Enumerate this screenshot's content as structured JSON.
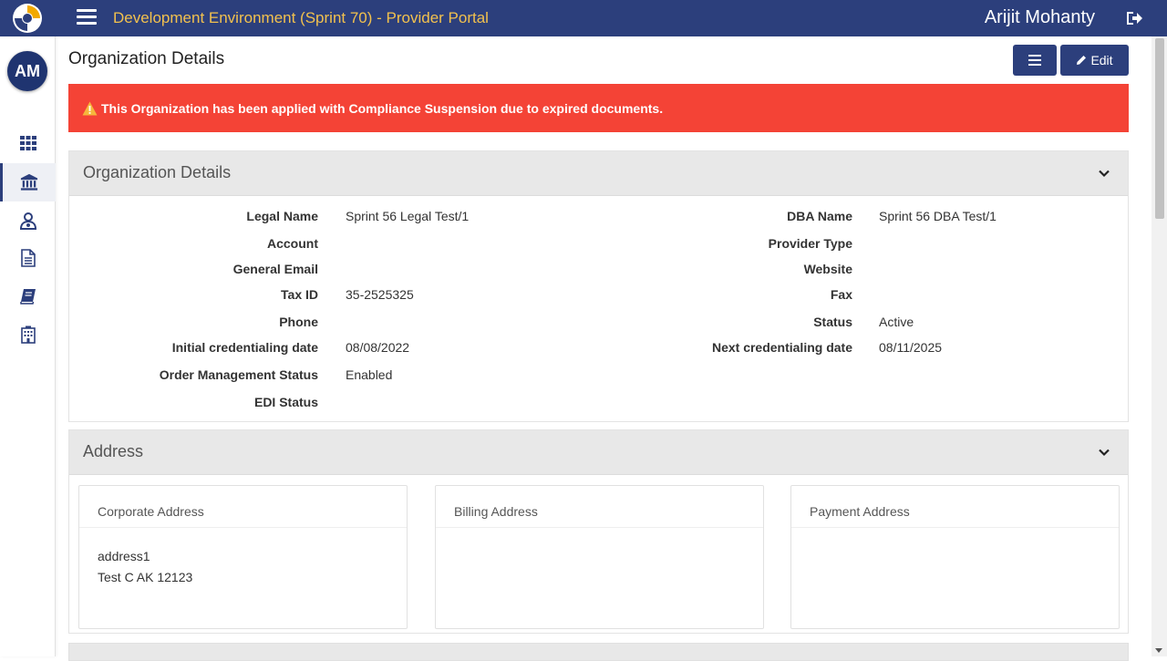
{
  "topbar": {
    "title": "Development Environment (Sprint 70) - Provider Portal",
    "user_name": "Arijit Mohanty"
  },
  "sidebar": {
    "avatar_initials": "AM",
    "items": [
      {
        "icon": "grid-icon"
      },
      {
        "icon": "bank-icon",
        "active": true
      },
      {
        "icon": "users-icon"
      },
      {
        "icon": "document-icon"
      },
      {
        "icon": "book-icon"
      },
      {
        "icon": "building-icon"
      }
    ]
  },
  "page": {
    "title": "Organization Details",
    "edit_label": "Edit"
  },
  "alert": {
    "message": "This Organization has been applied with Compliance Suspension due to expired documents."
  },
  "org_details": {
    "section_title": "Organization Details",
    "left": [
      {
        "label": "Legal Name",
        "value": "Sprint 56 Legal Test/1"
      },
      {
        "label": "Account",
        "value": ""
      },
      {
        "label": "General Email",
        "value": ""
      },
      {
        "label": "Tax ID",
        "value": "35-2525325"
      },
      {
        "label": "Phone",
        "value": ""
      },
      {
        "label": "Initial credentialing date",
        "value": "08/08/2022"
      },
      {
        "label": "Order Management Status",
        "value": "Enabled"
      },
      {
        "label": "EDI Status",
        "value": ""
      }
    ],
    "right": [
      {
        "label": "DBA Name",
        "value": "Sprint 56 DBA Test/1"
      },
      {
        "label": "Provider Type",
        "value": ""
      },
      {
        "label": "Website",
        "value": ""
      },
      {
        "label": "Fax",
        "value": ""
      },
      {
        "label": "Status",
        "value": "Active"
      },
      {
        "label": "Next credentialing date",
        "value": "08/11/2025"
      }
    ]
  },
  "address": {
    "section_title": "Address",
    "cards": [
      {
        "title": "Corporate Address",
        "line1": "address1",
        "line2": "Test C AK 12123"
      },
      {
        "title": "Billing Address",
        "line1": "",
        "line2": ""
      },
      {
        "title": "Payment Address",
        "line1": "",
        "line2": ""
      }
    ]
  },
  "colors": {
    "topbar": "#2c3f7c",
    "title_accent": "#f2c14e",
    "alert": "#f44336",
    "panel_header": "#e8e8e8"
  }
}
